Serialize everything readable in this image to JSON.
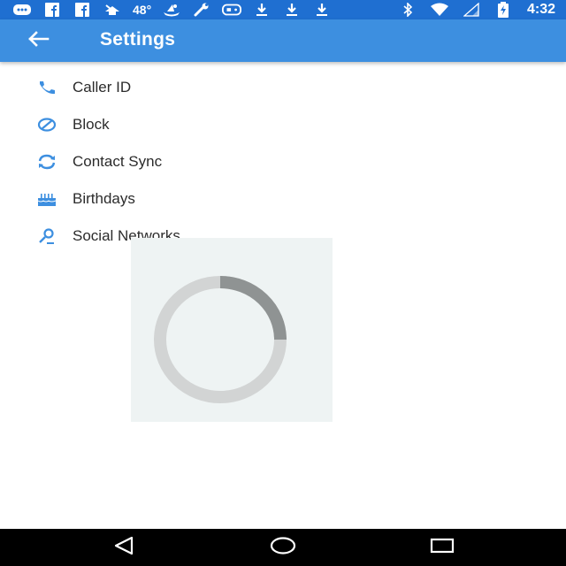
{
  "status_bar": {
    "temperature": "48°",
    "time": "4:32",
    "color": "#1f6fd1",
    "left_icons": [
      "message-icon",
      "facebook-icon",
      "facebook-icon",
      "weather-icon",
      "temperature",
      "boat-icon",
      "wrench-icon",
      "gamepad-icon",
      "download-icon",
      "download-icon",
      "download-icon"
    ],
    "right_icons": [
      "bluetooth-icon",
      "wifi-icon",
      "signal-icon",
      "battery-charging-icon"
    ]
  },
  "toolbar": {
    "title": "Settings",
    "color": "#3d8fe0",
    "back_icon": "arrow-left-icon"
  },
  "settings": {
    "accent_color": "#3d8fe0",
    "items": [
      {
        "label": "Caller ID",
        "icon": "phone-icon"
      },
      {
        "label": "Block",
        "icon": "block-icon"
      },
      {
        "label": "Contact Sync",
        "icon": "sync-icon"
      },
      {
        "label": "Birthdays",
        "icon": "cake-icon"
      },
      {
        "label": "Social Networks",
        "icon": "person-search-icon"
      }
    ]
  },
  "loading": {
    "icon": "progress-spinner",
    "progress_fraction": 0.25
  },
  "nav_bar": {
    "buttons": [
      "back-triangle-icon",
      "home-circle-icon",
      "recents-square-icon"
    ]
  }
}
